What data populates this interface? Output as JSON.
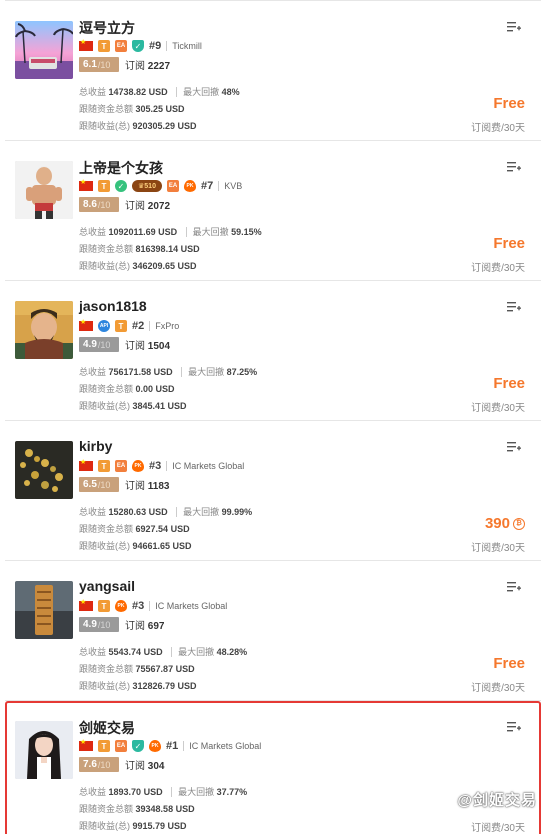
{
  "traders": [
    {
      "name": "逗号立方",
      "avatar": "palm-beach-avatar",
      "badges": [
        "flag",
        "T",
        "EA",
        "shield"
      ],
      "rank": "#9",
      "broker": "Tickmill",
      "score": "6.1",
      "score_max": "/10",
      "score_grey": false,
      "subs_label": "订阅",
      "subs": "2227",
      "total_profit_label": "总收益",
      "total_profit": "14738.82 USD",
      "max_dd_label": "最大回撤",
      "max_dd": "48%",
      "follow_funds_label": "跟随资金总额",
      "follow_funds": "305.25 USD",
      "follow_profit_label": "跟随收益(总)",
      "follow_profit": "920305.29 USD",
      "price": "Free",
      "period": "订阅费/30天"
    },
    {
      "name": "上帝是个女孩",
      "avatar": "fighter-avatar",
      "badges": [
        "flag",
        "T",
        "check",
        "510",
        "EA",
        "pk"
      ],
      "rank": "#7",
      "broker": "KVB",
      "score": "8.6",
      "score_max": "/10",
      "score_grey": false,
      "subs_label": "订阅",
      "subs": "2072",
      "total_profit_label": "总收益",
      "total_profit": "1092011.69 USD",
      "max_dd_label": "最大回撤",
      "max_dd": "59.15%",
      "follow_funds_label": "跟随资金总额",
      "follow_funds": "816398.14 USD",
      "follow_profit_label": "跟随收益(总)",
      "follow_profit": "346209.65 USD",
      "price": "Free",
      "period": "订阅费/30天"
    },
    {
      "name": "jason1818",
      "avatar": "general-avatar",
      "badges": [
        "flag",
        "API",
        "T"
      ],
      "rank": "#2",
      "broker": "FxPro",
      "score": "4.9",
      "score_max": "/10",
      "score_grey": true,
      "subs_label": "订阅",
      "subs": "1504",
      "total_profit_label": "总收益",
      "total_profit": "756171.58 USD",
      "max_dd_label": "最大回撤",
      "max_dd": "87.25%",
      "follow_funds_label": "跟随资金总额",
      "follow_funds": "0.00 USD",
      "follow_profit_label": "跟随收益(总)",
      "follow_profit": "3845.41 USD",
      "price": "Free",
      "period": "订阅费/30天"
    },
    {
      "name": "kirby",
      "avatar": "bracelet-avatar",
      "badges": [
        "flag",
        "T",
        "EA",
        "pk"
      ],
      "rank": "#3",
      "broker": "IC Markets Global",
      "score": "6.5",
      "score_max": "/10",
      "score_grey": false,
      "subs_label": "订阅",
      "subs": "1183",
      "total_profit_label": "总收益",
      "total_profit": "15280.63 USD",
      "max_dd_label": "最大回撤",
      "max_dd": "99.99%",
      "follow_funds_label": "跟随资金总额",
      "follow_funds": "6927.54 USD",
      "follow_profit_label": "跟随收益(总)",
      "follow_profit": "94661.65 USD",
      "price": "390",
      "price_coin": "₿",
      "period": "订阅费/30天"
    },
    {
      "name": "yangsail",
      "avatar": "wood-avatar",
      "badges": [
        "flag",
        "T",
        "pk"
      ],
      "rank": "#3",
      "broker": "IC Markets Global",
      "score": "4.9",
      "score_max": "/10",
      "score_grey": true,
      "subs_label": "订阅",
      "subs": "697",
      "total_profit_label": "总收益",
      "total_profit": "5543.74 USD",
      "max_dd_label": "最大回撤",
      "max_dd": "48.28%",
      "follow_funds_label": "跟随资金总额",
      "follow_funds": "75567.87 USD",
      "follow_profit_label": "跟随收益(总)",
      "follow_profit": "312826.79 USD",
      "price": "Free",
      "period": "订阅费/30天"
    },
    {
      "name": "剑姬交易",
      "avatar": "girl-avatar",
      "badges": [
        "flag",
        "T",
        "EA",
        "shield",
        "pk"
      ],
      "rank": "#1",
      "broker": "IC Markets Global",
      "score": "7.6",
      "score_max": "/10",
      "score_grey": false,
      "subs_label": "订阅",
      "subs": "304",
      "total_profit_label": "总收益",
      "total_profit": "1893.70 USD",
      "max_dd_label": "最大回撤",
      "max_dd": "37.77%",
      "follow_funds_label": "跟随资金总额",
      "follow_funds": "39348.58 USD",
      "follow_profit_label": "跟随收益(总)",
      "follow_profit": "9915.79 USD",
      "price": "",
      "period": "订阅费/30天",
      "highlight": true
    }
  ],
  "watermark": "@剑姬交易",
  "colors": {
    "accent": "#f5782d",
    "highlight_border": "#e53935",
    "score_bg": "#c9a17b",
    "score_grey_bg": "#9a9a9a"
  }
}
